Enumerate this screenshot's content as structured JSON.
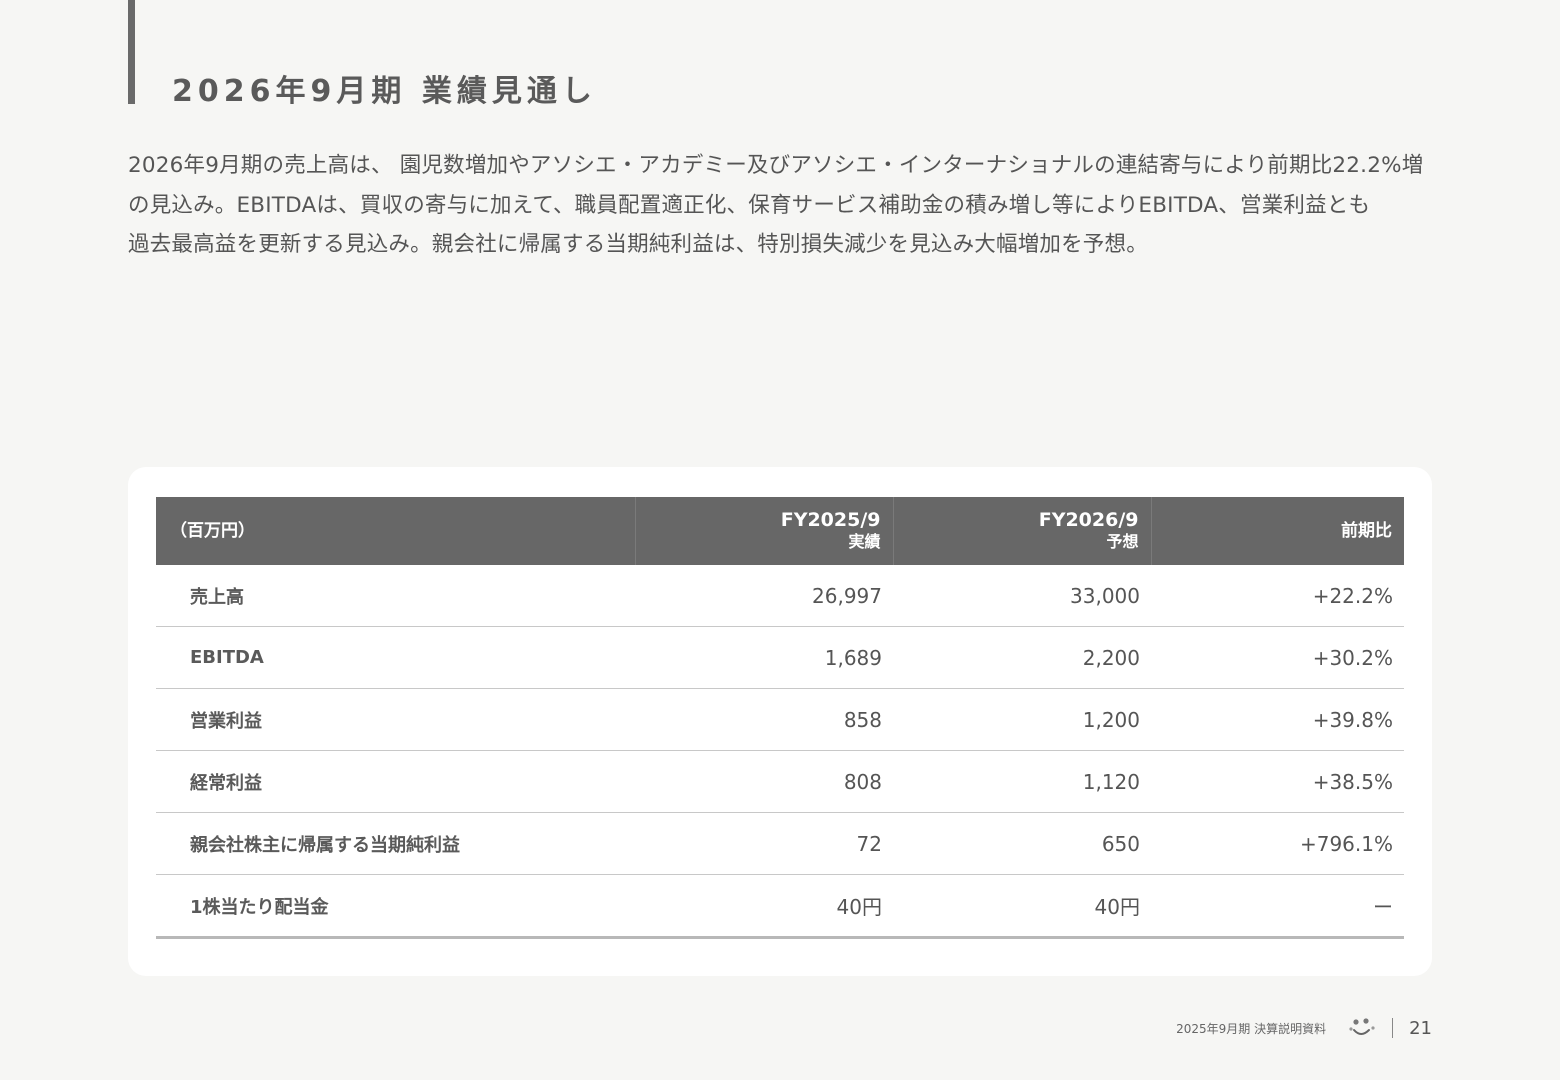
{
  "title": "2026年9月期 業績見通し",
  "intro": {
    "line1": "2026年9月期の売上高は、 園児数増加やアソシエ・アカデミー及びアソシエ・インターナショナルの連結寄与により前期比22.2%増",
    "line2": "の見込み。EBITDAは、買収の寄与に加えて、職員配置適正化、保育サービス補助金の積み増し等によりEBITDA、営業利益とも",
    "line3": "過去最高益を更新する見込み。親会社に帰属する当期純利益は、特別損失減少を見込み大幅増加を予想。"
  },
  "table": {
    "header": {
      "unit": "（百万円）",
      "col1_line1": "FY2025/9",
      "col1_line2": "実績",
      "col2_line1": "FY2026/9",
      "col2_line2": "予想",
      "col3": "前期比"
    },
    "rows": [
      {
        "label": "売上高",
        "fy2025": "26,997",
        "fy2026": "33,000",
        "change": "+22.2%"
      },
      {
        "label": "EBITDA",
        "fy2025": "1,689",
        "fy2026": "2,200",
        "change": "+30.2%"
      },
      {
        "label": "営業利益",
        "fy2025": "858",
        "fy2026": "1,200",
        "change": "+39.8%"
      },
      {
        "label": "経常利益",
        "fy2025": "808",
        "fy2026": "1,120",
        "change": "+38.5%"
      },
      {
        "label": "親会社株主に帰属する当期純利益",
        "fy2025": "72",
        "fy2026": "650",
        "change": "+796.1%"
      },
      {
        "label": "1株当たり配当金",
        "fy2025": "40円",
        "fy2026": "40円",
        "change": "ー"
      }
    ]
  },
  "footer": {
    "doc_title": "2025年9月期 決算説明資料",
    "page_number": "21",
    "logo_icon": "smiling-face-logo-icon"
  },
  "colors": {
    "background": "#f6f6f4",
    "header_fill": "#676767",
    "text": "#555555",
    "accent_bar": "#6a6a6a"
  }
}
